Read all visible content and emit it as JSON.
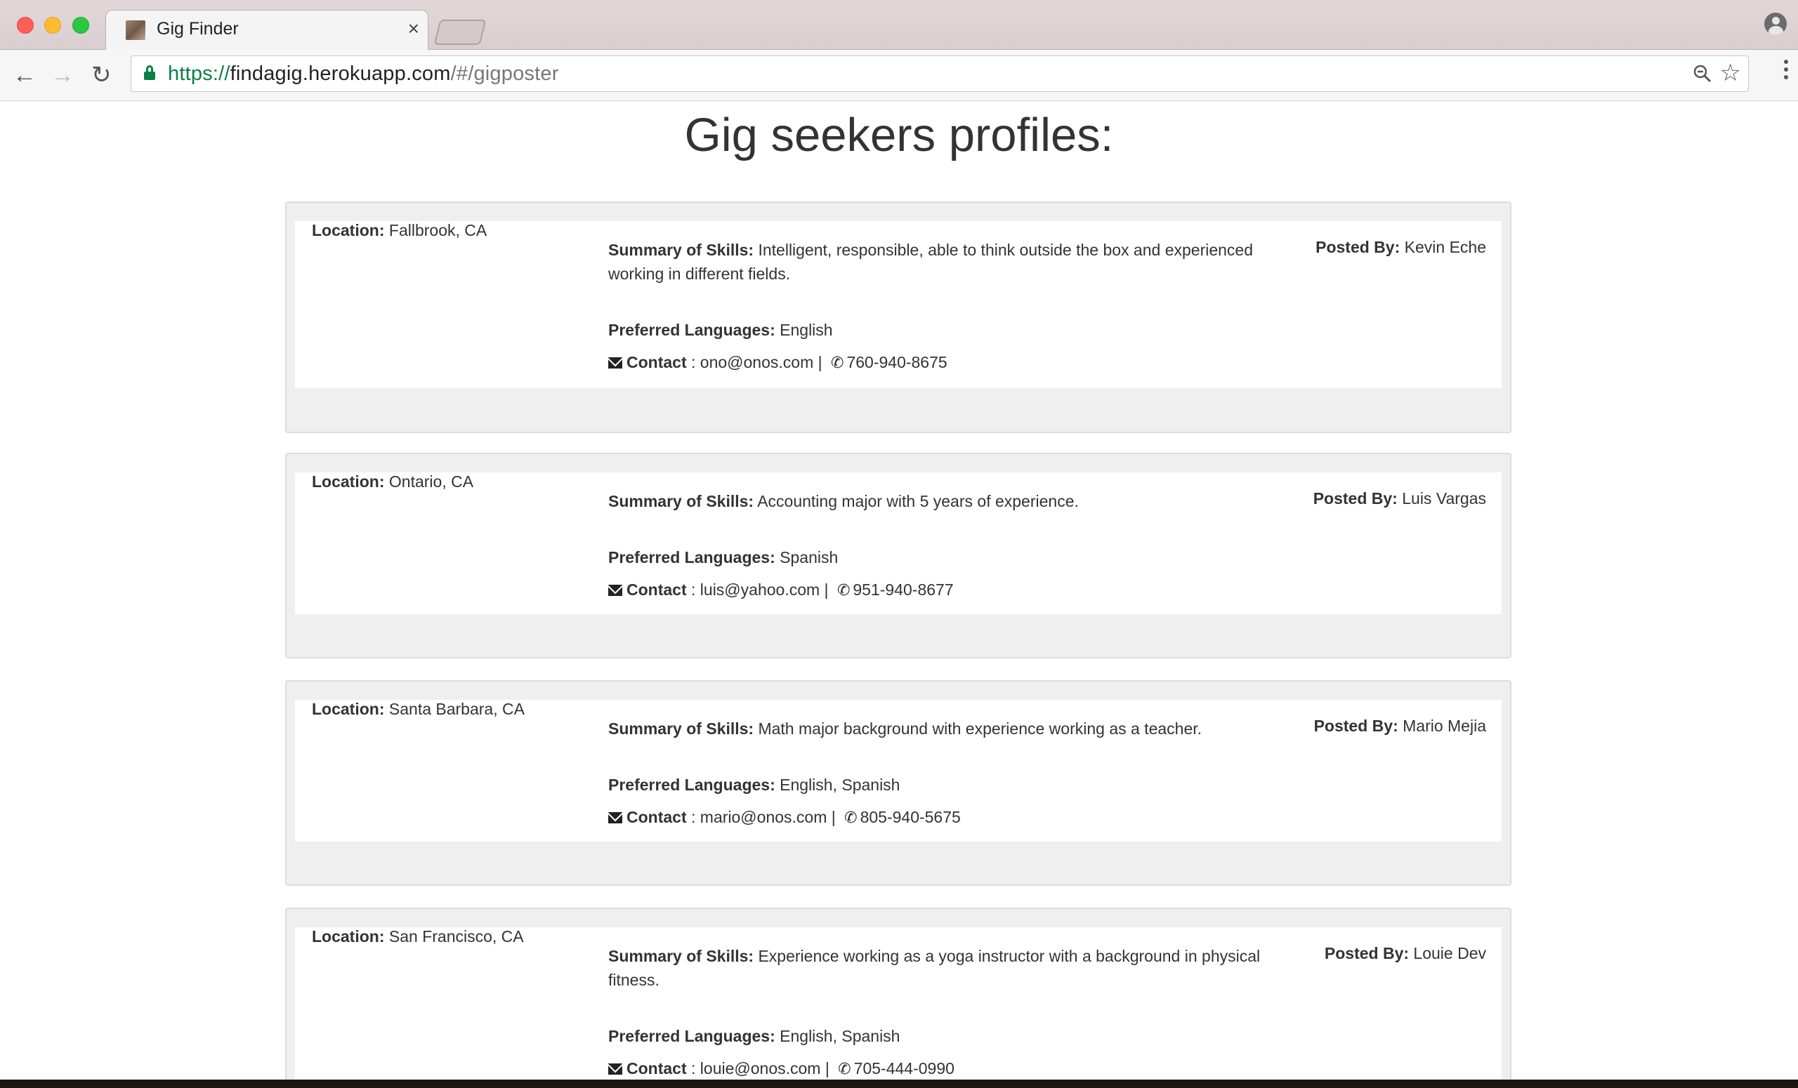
{
  "browser": {
    "tab_title": "Gig Finder",
    "close_glyph": "×",
    "url_scheme": "https://",
    "url_host": "findagig.herokuapp.com",
    "url_path": "/#/gigposter",
    "icons": [
      "back-arrow-icon",
      "forward-arrow-icon",
      "reload-icon",
      "lock-icon",
      "zoom-icon",
      "star-icon",
      "menu-icon",
      "profile-icon"
    ]
  },
  "page": {
    "title": "Gig seekers profiles:"
  },
  "labels": {
    "location": "Location:",
    "summary": "Summary of Skills:",
    "posted_by": "Posted By:",
    "languages": "Preferred Languages:",
    "contact": "Contact",
    "contact_sep": " : ",
    "pipe": " | "
  },
  "profiles": [
    {
      "location": "Fallbrook, CA",
      "summary": "Intelligent, responsible, able to think outside the box and experienced working in different fields.",
      "posted_by": "Kevin Eche",
      "languages": "English",
      "email": "ono@onos.com",
      "phone": "760-940-8675"
    },
    {
      "location": "Ontario, CA",
      "summary": "Accounting major with 5 years of experience.",
      "posted_by": "Luis Vargas",
      "languages": "Spanish",
      "email": "luis@yahoo.com",
      "phone": "951-940-8677"
    },
    {
      "location": "Santa Barbara, CA",
      "summary": "Math major background with experience working as a teacher.",
      "posted_by": "Mario Mejia",
      "languages": "English, Spanish",
      "email": "mario@onos.com",
      "phone": "805-940-5675"
    },
    {
      "location": "San Francisco, CA",
      "summary": "Experience working as a yoga instructor with a background in physical fitness.",
      "posted_by": "Louie Dev",
      "languages": "English, Spanish",
      "email": "louie@onos.com",
      "phone": "705-444-0990"
    }
  ]
}
